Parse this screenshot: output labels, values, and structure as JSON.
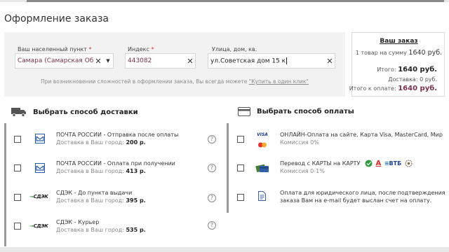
{
  "page": {
    "title": "Оформление заказа"
  },
  "address": {
    "city": {
      "label": "Ваш населенный пункт",
      "required_mark": "*",
      "value": "Самара (Самарская Обл)"
    },
    "index": {
      "label": "Индекс",
      "required_mark": "*",
      "value": "443082"
    },
    "street": {
      "label": "Улица, дом, кв.",
      "value": "ул.Советская дом 15 к"
    },
    "note_prefix": "При возникновении сложностей в оформлении заказа, Вы всегда можете",
    "note_link": "\"Купить в один клик\""
  },
  "summary": {
    "title": "Ваш заказ",
    "items_text": "1 товар на сумму",
    "items_sum": "1640 руб.",
    "total_label": "Итого:",
    "total_value": "1640 руб.",
    "delivery_label": "Доставка:",
    "delivery_value": "0 руб.",
    "pay_label": "Итого к оплате:",
    "pay_value": "1640 руб."
  },
  "delivery": {
    "title": "Выбрать способ доставки",
    "icon": "truck-icon",
    "items": [
      {
        "name": "ПОЧТА РОССИИ - Отправка после оплаты",
        "price_label": "Доставка в Ваш город:",
        "price": "200 р.",
        "icon": "russian-post-icon"
      },
      {
        "name": "ПОЧТА РОССИИ - Оплата при получении",
        "price_label": "Доставка в Ваш город:",
        "price": "413 р.",
        "icon": "russian-post-icon"
      },
      {
        "name": "СДЭК - До пункта выдачи",
        "price_label": "Доставка в Ваш город:",
        "price": "395 р.",
        "icon": "cdek-logo"
      },
      {
        "name": "СДЭК - Курьер",
        "price_label": "Доставка в Ваш город:",
        "price": "535 р.",
        "icon": "cdek-logo"
      }
    ],
    "logo_text": "СДЭК"
  },
  "payment": {
    "title": "Выбрать способ оплаты",
    "icon": "card-icon",
    "items": [
      {
        "name": "ОНЛАЙН-Оплата на сайте. Карта Visa, MasterCard, Мир",
        "sub": "Комиссия 0%",
        "icon": "visa-mastercard-icon"
      },
      {
        "name": "Перевод с КАРТЫ на КАРТУ",
        "sub": "Комиссия 0-1%",
        "icon": "cards-icon",
        "bank_vtb": "ВТБ"
      },
      {
        "name": "Оплата для юридического лица, после подтверждения",
        "name2": "заказа Вам на e-mail будет выслан счет на оплату.",
        "icon": "invoice-document-icon"
      }
    ],
    "visa_text": "VISA"
  },
  "colors": {
    "accent": "#7b2f4e",
    "panel": "#f2f2f2",
    "cdek_green": "#2e8b2e"
  }
}
